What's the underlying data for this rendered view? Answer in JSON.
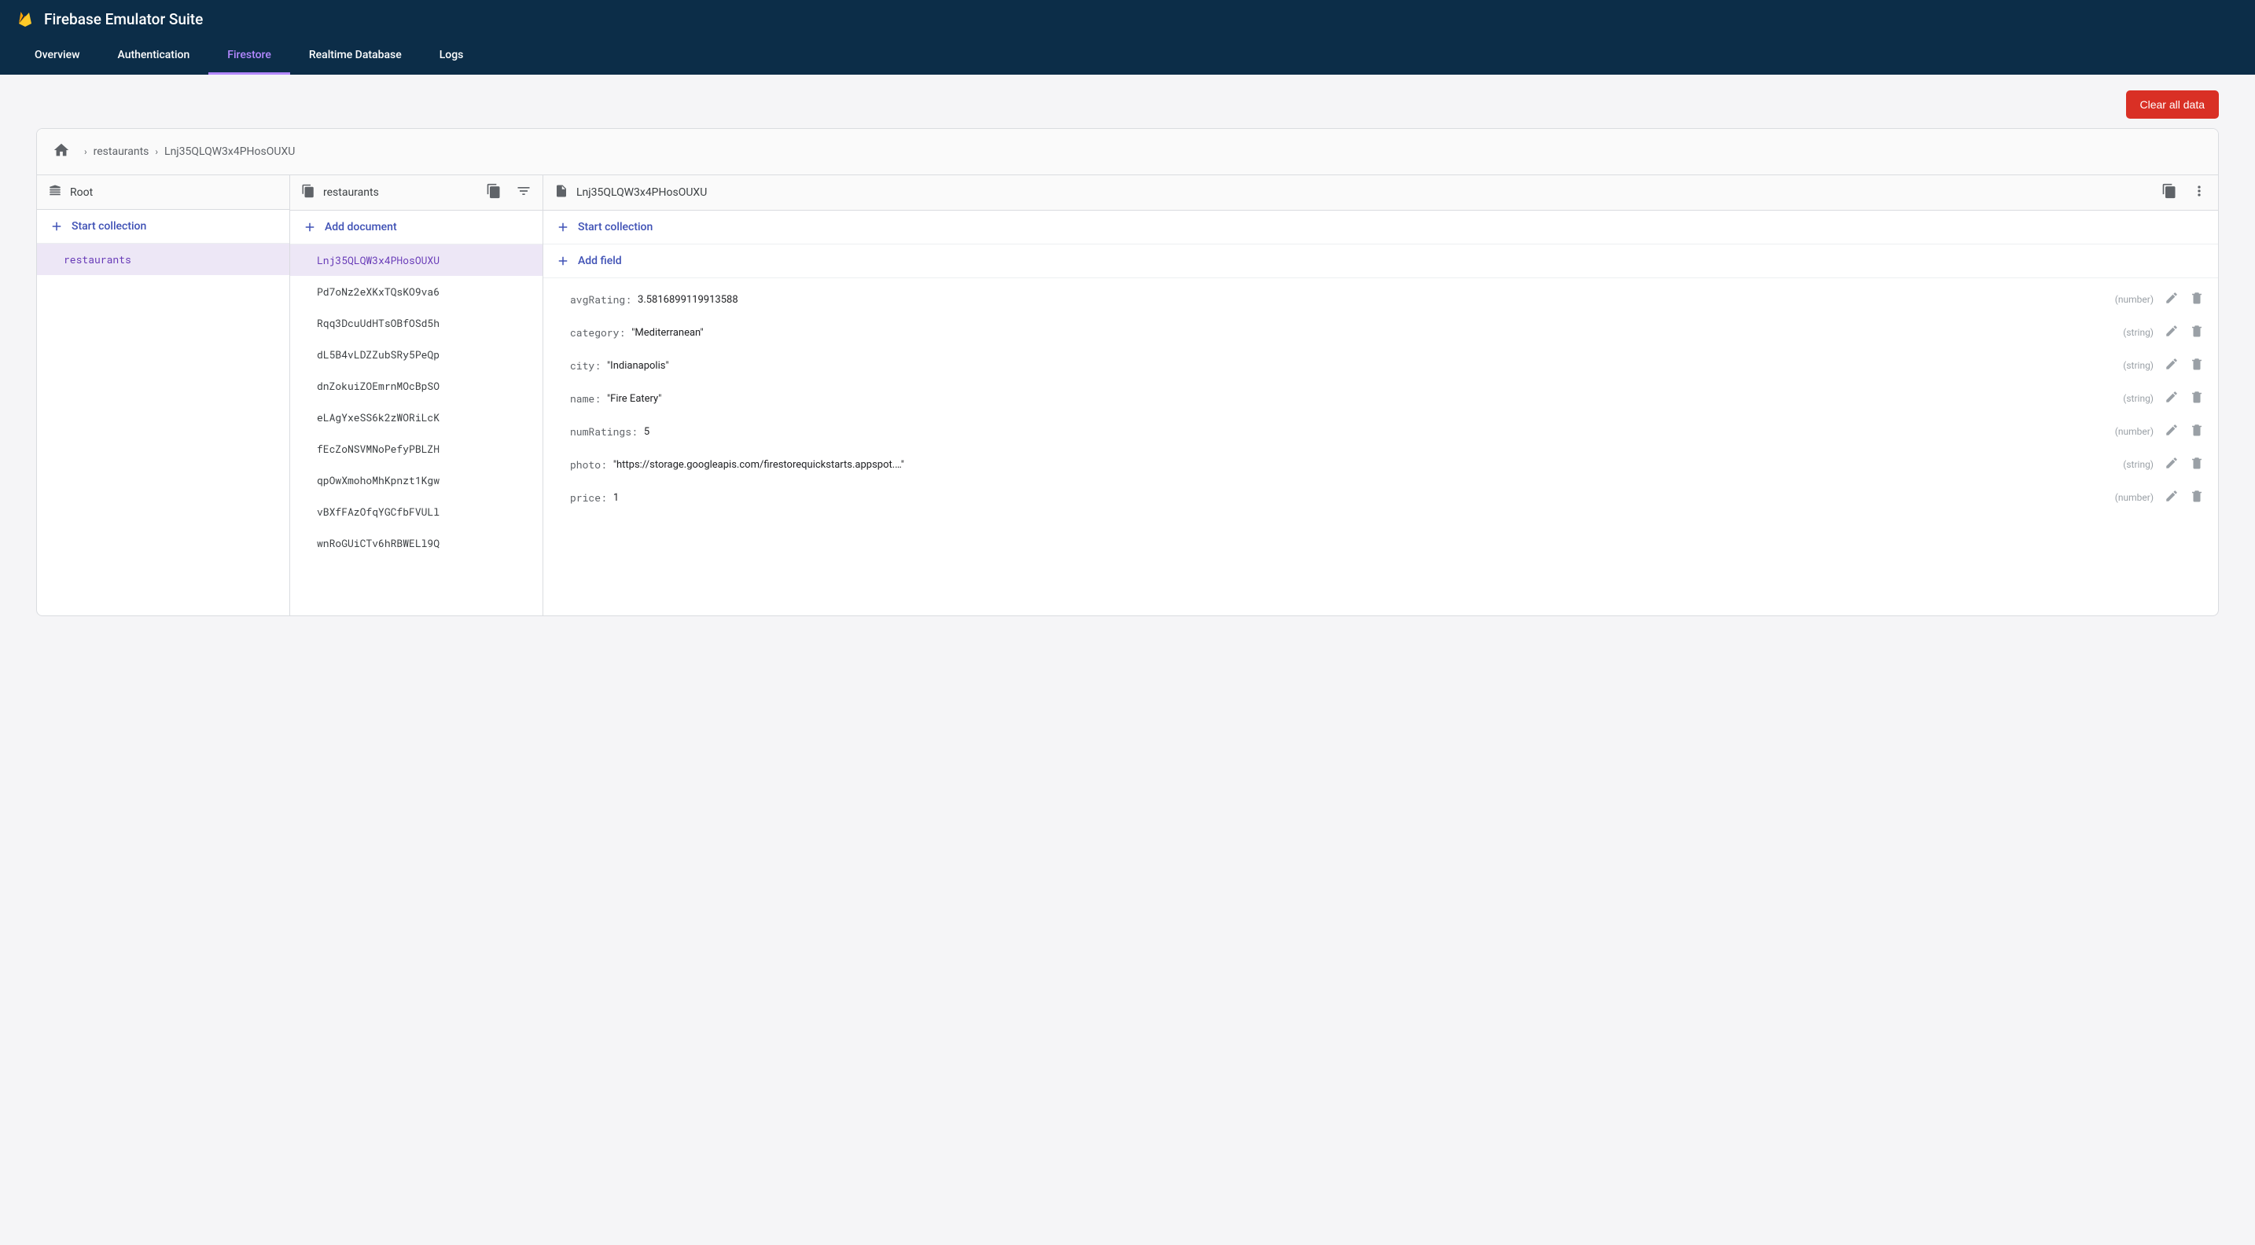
{
  "header": {
    "title": "Firebase Emulator Suite",
    "tabs": [
      "Overview",
      "Authentication",
      "Firestore",
      "Realtime Database",
      "Logs"
    ],
    "active_tab": 2
  },
  "toolbar": {
    "clear_button": "Clear all data"
  },
  "breadcrumb": {
    "items": [
      "restaurants",
      "Lnj35QLQW3x4PHosOUXU"
    ]
  },
  "col1": {
    "title": "Root",
    "action": "Start collection",
    "items": [
      "restaurants"
    ],
    "selected": 0
  },
  "col2": {
    "title": "restaurants",
    "action": "Add document",
    "items": [
      "Lnj35QLQW3x4PHosOUXU",
      "Pd7oNz2eXKxTQsKO9va6",
      "Rqq3DcuUdHTsOBfOSd5h",
      "dL5B4vLDZZubSRy5PeQp",
      "dnZokuiZOEmrnMOcBpSO",
      "eLAgYxeSS6k2zWORiLcK",
      "fEcZoNSVMNoPefyPBLZH",
      "qpOwXmohoMhKpnzt1Kgw",
      "vBXfFAzOfqYGCfbFVULl",
      "wnRoGUiCTv6hRBWELl9Q"
    ],
    "selected": 0
  },
  "col3": {
    "title": "Lnj35QLQW3x4PHosOUXU",
    "action1": "Start collection",
    "action2": "Add field",
    "fields": [
      {
        "key": "avgRating",
        "value": "3.5816899119913588",
        "type": "number",
        "quoted": false
      },
      {
        "key": "category",
        "value": "Mediterranean",
        "type": "string",
        "quoted": true
      },
      {
        "key": "city",
        "value": "Indianapolis",
        "type": "string",
        "quoted": true
      },
      {
        "key": "name",
        "value": "Fire Eatery",
        "type": "string",
        "quoted": true
      },
      {
        "key": "numRatings",
        "value": "5",
        "type": "number",
        "quoted": false
      },
      {
        "key": "photo",
        "value": "https://storage.googleapis.com/firestorequickstarts.appspot.…",
        "type": "string",
        "quoted": true
      },
      {
        "key": "price",
        "value": "1",
        "type": "number",
        "quoted": false
      }
    ]
  }
}
